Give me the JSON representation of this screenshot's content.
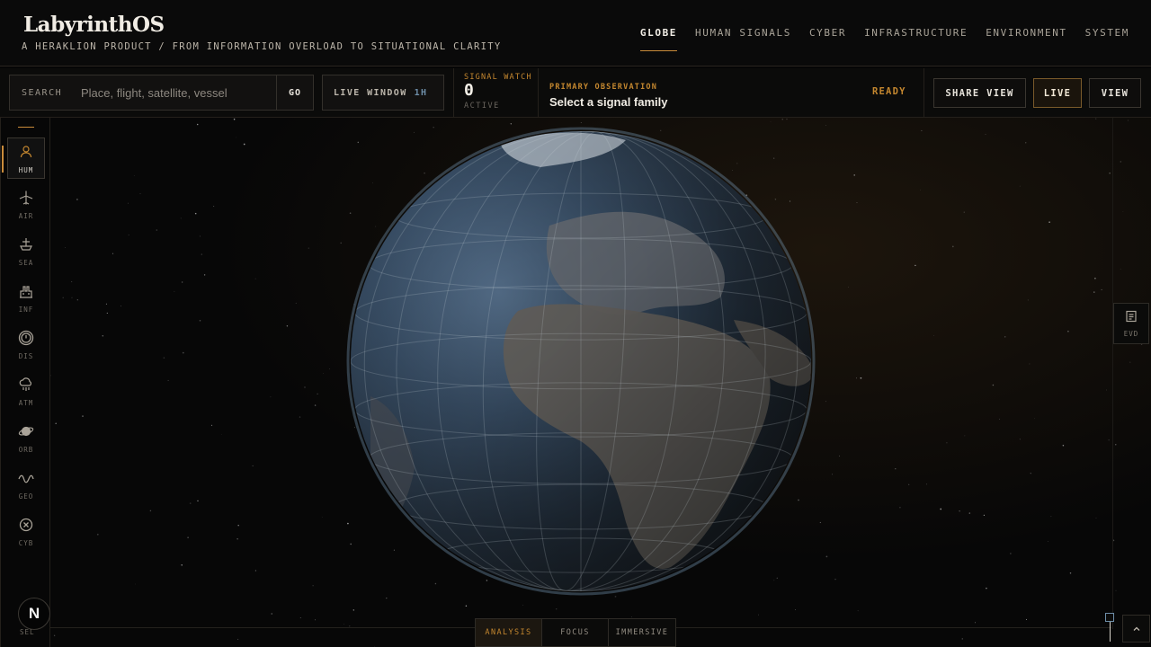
{
  "app": {
    "brand": "LabyrinthOS",
    "tagline": "A HERAKLION PRODUCT / FROM INFORMATION OVERLOAD TO SITUATIONAL CLARITY"
  },
  "nav": {
    "items": [
      {
        "label": "GLOBE",
        "active": true
      },
      {
        "label": "HUMAN SIGNALS",
        "active": false
      },
      {
        "label": "CYBER",
        "active": false
      },
      {
        "label": "INFRASTRUCTURE",
        "active": false
      },
      {
        "label": "ENVIRONMENT",
        "active": false
      },
      {
        "label": "SYSTEM",
        "active": false
      }
    ]
  },
  "toolbar": {
    "search_label": "SEARCH",
    "search_placeholder": "Place, flight, satellite, vessel",
    "go_label": "GO",
    "live_window_label": "LIVE WINDOW",
    "live_window_value": "1H",
    "signal_watch_title": "SIGNAL WATCH",
    "signal_watch_count": "0",
    "signal_watch_sub": "ACTIVE",
    "primary_obs_title": "PRIMARY OBSERVATION",
    "primary_obs_value": "Select a signal family",
    "status": "READY",
    "share_label": "SHARE VIEW",
    "live_label": "LIVE",
    "view_label": "VIEW"
  },
  "rail": {
    "items": [
      {
        "code": "HUM",
        "icon": "person-icon",
        "active": true
      },
      {
        "code": "AIR",
        "icon": "airplane-icon",
        "active": false
      },
      {
        "code": "SEA",
        "icon": "ship-icon",
        "active": false
      },
      {
        "code": "INF",
        "icon": "factory-icon",
        "active": false
      },
      {
        "code": "DIS",
        "icon": "alert-circle-icon",
        "active": false
      },
      {
        "code": "ATM",
        "icon": "cloud-rain-icon",
        "active": false
      },
      {
        "code": "ORB",
        "icon": "planet-icon",
        "active": false
      },
      {
        "code": "GEO",
        "icon": "wave-icon",
        "active": false
      },
      {
        "code": "CYB",
        "icon": "shield-x-icon",
        "active": false
      }
    ],
    "badge": "N",
    "bottom_code": "SEL"
  },
  "side_panel": {
    "code": "EVD",
    "icon": "document-icon"
  },
  "modes": [
    {
      "label": "ANALYSIS",
      "active": true
    },
    {
      "label": "FOCUS",
      "active": false
    },
    {
      "label": "IMMERSIVE",
      "active": false
    }
  ],
  "colors": {
    "accent": "#c4872f",
    "secondary": "#6e8ea8",
    "background": "#060606"
  }
}
